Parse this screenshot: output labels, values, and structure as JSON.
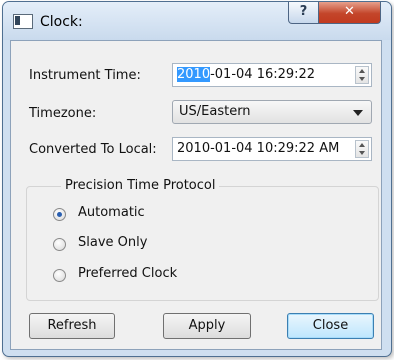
{
  "window": {
    "title": "Clock:",
    "help_label": "?",
    "close_label": "✕"
  },
  "instrument_time": {
    "label": "Instrument Time:",
    "value_selected": "2010",
    "value_rest": "-01-04 16:29:22"
  },
  "timezone": {
    "label": "Timezone:",
    "value": "US/Eastern"
  },
  "converted": {
    "label": "Converted To Local:",
    "value": "2010-01-04 10:29:22 AM"
  },
  "ptp": {
    "title": "Precision Time Protocol",
    "options": [
      {
        "label": "Automatic",
        "checked": true
      },
      {
        "label": "Slave Only",
        "checked": false
      },
      {
        "label": "Preferred Clock",
        "checked": false
      }
    ]
  },
  "buttons": {
    "refresh": "Refresh",
    "apply": "Apply",
    "close": "Close"
  }
}
